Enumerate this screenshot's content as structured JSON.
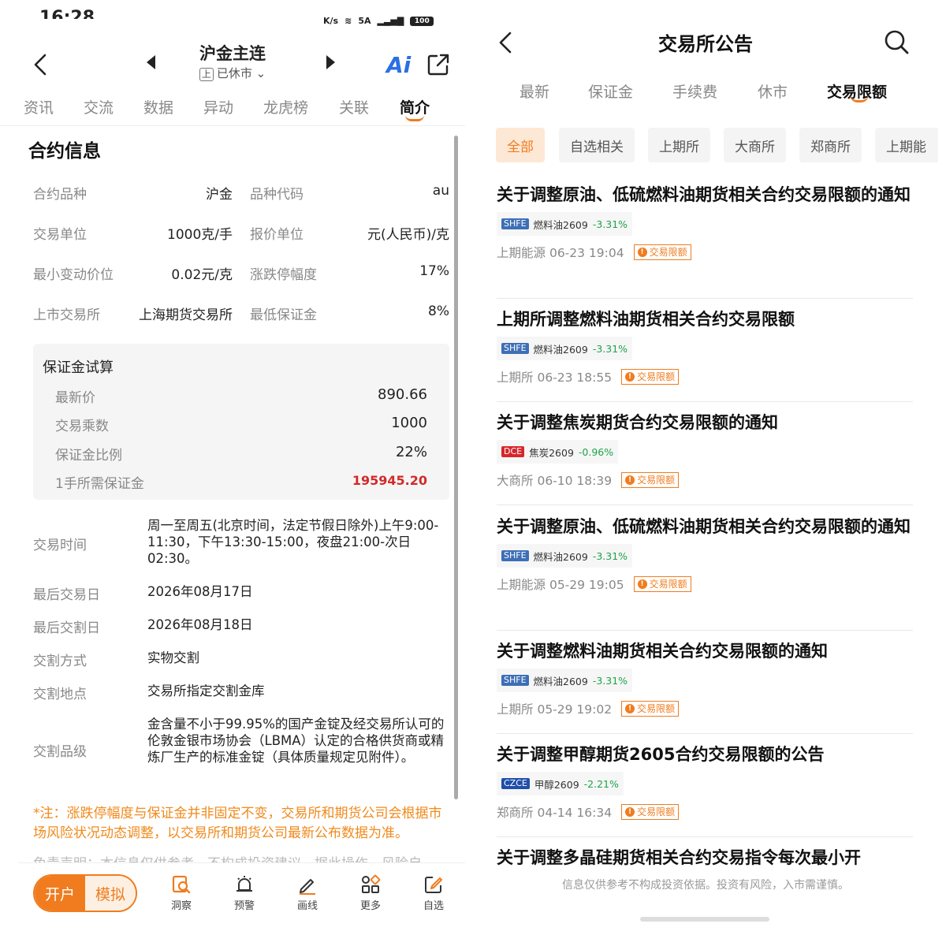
{
  "left": {
    "status": {
      "time": "16:28",
      "net": "K/s",
      "signal": "5A",
      "battery": "100"
    },
    "header": {
      "title": "沪金主连",
      "exchange_tag": "上",
      "status": "已休市"
    },
    "ai_label": "Ai",
    "tabs": [
      "资讯",
      "交流",
      "数据",
      "异动",
      "龙虎榜",
      "关联",
      "简介"
    ],
    "active_tab": "简介",
    "section_title": "合约信息",
    "info": [
      {
        "label": "合约品种",
        "value": "沪金",
        "label2": "品种代码",
        "value2": "au"
      },
      {
        "label": "交易单位",
        "value": "1000克/手",
        "label2": "报价单位",
        "value2": "元(人民币)/克"
      },
      {
        "label": "最小变动价位",
        "value": "0.02元/克",
        "label2": "涨跌停幅度",
        "value2": "17%"
      },
      {
        "label": "上市交易所",
        "value": "上海期货交易所",
        "label2": "最低保证金",
        "value2": "8%"
      }
    ],
    "margin_calc": {
      "title": "保证金试算",
      "rows": [
        {
          "label": "最新价",
          "value": "890.66"
        },
        {
          "label": "交易乘数",
          "value": "1000"
        },
        {
          "label": "保证金比例",
          "value": "22%"
        },
        {
          "label": "1手所需保证金",
          "value": "195945.20"
        }
      ]
    },
    "details": [
      {
        "label": "交易时间",
        "value": "周一至周五(北京时间，法定节假日除外)上午9:00-11:30，下午13:30-15:00，夜盘21:00-次日02:30。"
      },
      {
        "label": "最后交易日",
        "value": "2026年08月17日"
      },
      {
        "label": "最后交割日",
        "value": "2026年08月18日"
      },
      {
        "label": "交割方式",
        "value": "实物交割"
      },
      {
        "label": "交割地点",
        "value": "交易所指定交割金库"
      },
      {
        "label": "交割品级",
        "value": "金含量不小于99.95%的国产金锭及经交易所认可的伦敦金银市场协会（LBMA）认定的合格供货商或精炼厂生产的标准金锭（具体质量规定见附件）。"
      }
    ],
    "note": "*注：涨跌停幅度与保证金并非固定不变，交易所和期货公司会根据市场风险状况动态调整，以交易所和期货公司最新公布数据为准。",
    "faded_text": "免责声明：本信息仅供参考，不构成投资建议，据此操作，风险自",
    "bottom": {
      "open": "开户",
      "sim": "模拟",
      "tools": [
        "洞察",
        "预警",
        "画线",
        "更多",
        "自选"
      ]
    }
  },
  "right": {
    "title": "交易所公告",
    "tabs": [
      "最新",
      "保证金",
      "手续费",
      "休市",
      "交易限额"
    ],
    "active_tab": "交易限额",
    "chips": [
      "全部",
      "自选相关",
      "上期所",
      "大商所",
      "郑商所",
      "上期能"
    ],
    "active_chip": "全部",
    "items": [
      {
        "title": "关于调整原油、低硫燃料油期货相关合约交易限额的通知",
        "exchange": "SHFE",
        "contract": "燃料油2609",
        "change": "-3.31%",
        "source": "上期能源",
        "time": "06-23 19:04",
        "badge": "交易限额"
      },
      {
        "title": "上期所调整燃料油期货相关合约交易限额",
        "exchange": "SHFE",
        "contract": "燃料油2609",
        "change": "-3.31%",
        "source": "上期所",
        "time": "06-23 18:55",
        "badge": "交易限额"
      },
      {
        "title": "关于调整焦炭期货合约交易限额的通知",
        "exchange": "DCE",
        "contract": "焦炭2609",
        "change": "-0.96%",
        "source": "大商所",
        "time": "06-10 18:39",
        "badge": "交易限额"
      },
      {
        "title": "关于调整原油、低硫燃料油期货相关合约交易限额的通知",
        "exchange": "SHFE",
        "contract": "燃料油2609",
        "change": "-3.31%",
        "source": "上期能源",
        "time": "05-29 19:05",
        "badge": "交易限额"
      },
      {
        "title": "关于调整燃料油期货相关合约交易限额的通知",
        "exchange": "SHFE",
        "contract": "燃料油2609",
        "change": "-3.31%",
        "source": "上期所",
        "time": "05-29 19:02",
        "badge": "交易限额"
      },
      {
        "title": "关于调整甲醇期货2605合约交易限额的公告",
        "exchange": "CZCE",
        "contract": "甲醇2609",
        "change": "-2.21%",
        "source": "郑商所",
        "time": "04-14 16:34",
        "badge": "交易限额"
      },
      {
        "title": "关于调整多晶硅期货相关合约交易指令每次最小开",
        "exchange": "",
        "contract": "",
        "change": "",
        "source": "",
        "time": "",
        "badge": ""
      }
    ],
    "footer": "信息仅供参考不构成投资依据。投资有风险，入市需谨慎。"
  },
  "colors": {
    "accent": "#f07c1f",
    "up_red": "#d22a2a",
    "down_green": "#1fa34a",
    "ai_blue": "#2b6fe6"
  }
}
